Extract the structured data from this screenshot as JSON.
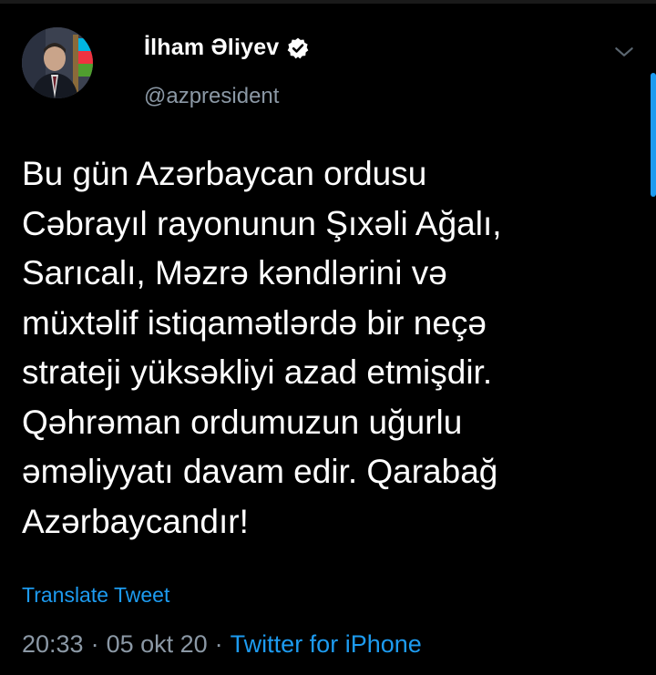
{
  "author": {
    "name": "İlham Əliyev",
    "handle": "@azpresident",
    "verified": true,
    "avatar_icon": "profile-photo-avatar"
  },
  "tweet": {
    "lines": [
      "Bu gün Azərbaycan ordusu",
      "Cəbrayıl rayonunun Şıxəli Ağalı,",
      "Sarıcalı, Məzrə kəndlərini və",
      "müxtəlif istiqamətlərdə bir neçə",
      "strateji yüksəkliyi azad etmişdir.",
      "Qəhrəman ordumuzun uğurlu",
      "əməliyyatı davam edir. Qarabağ",
      "Azərbaycandır!"
    ]
  },
  "translate_label": "Translate Tweet",
  "meta": {
    "time": "20:33",
    "separator": "·",
    "date": "05 okt 20",
    "source": "Twitter for iPhone"
  },
  "icons": {
    "verified": "verified-badge-icon",
    "menu": "chevron-down-icon"
  },
  "colors": {
    "background": "#000000",
    "text": "#ffffff",
    "secondary": "#8b98a5",
    "accent": "#1d9bf0"
  }
}
